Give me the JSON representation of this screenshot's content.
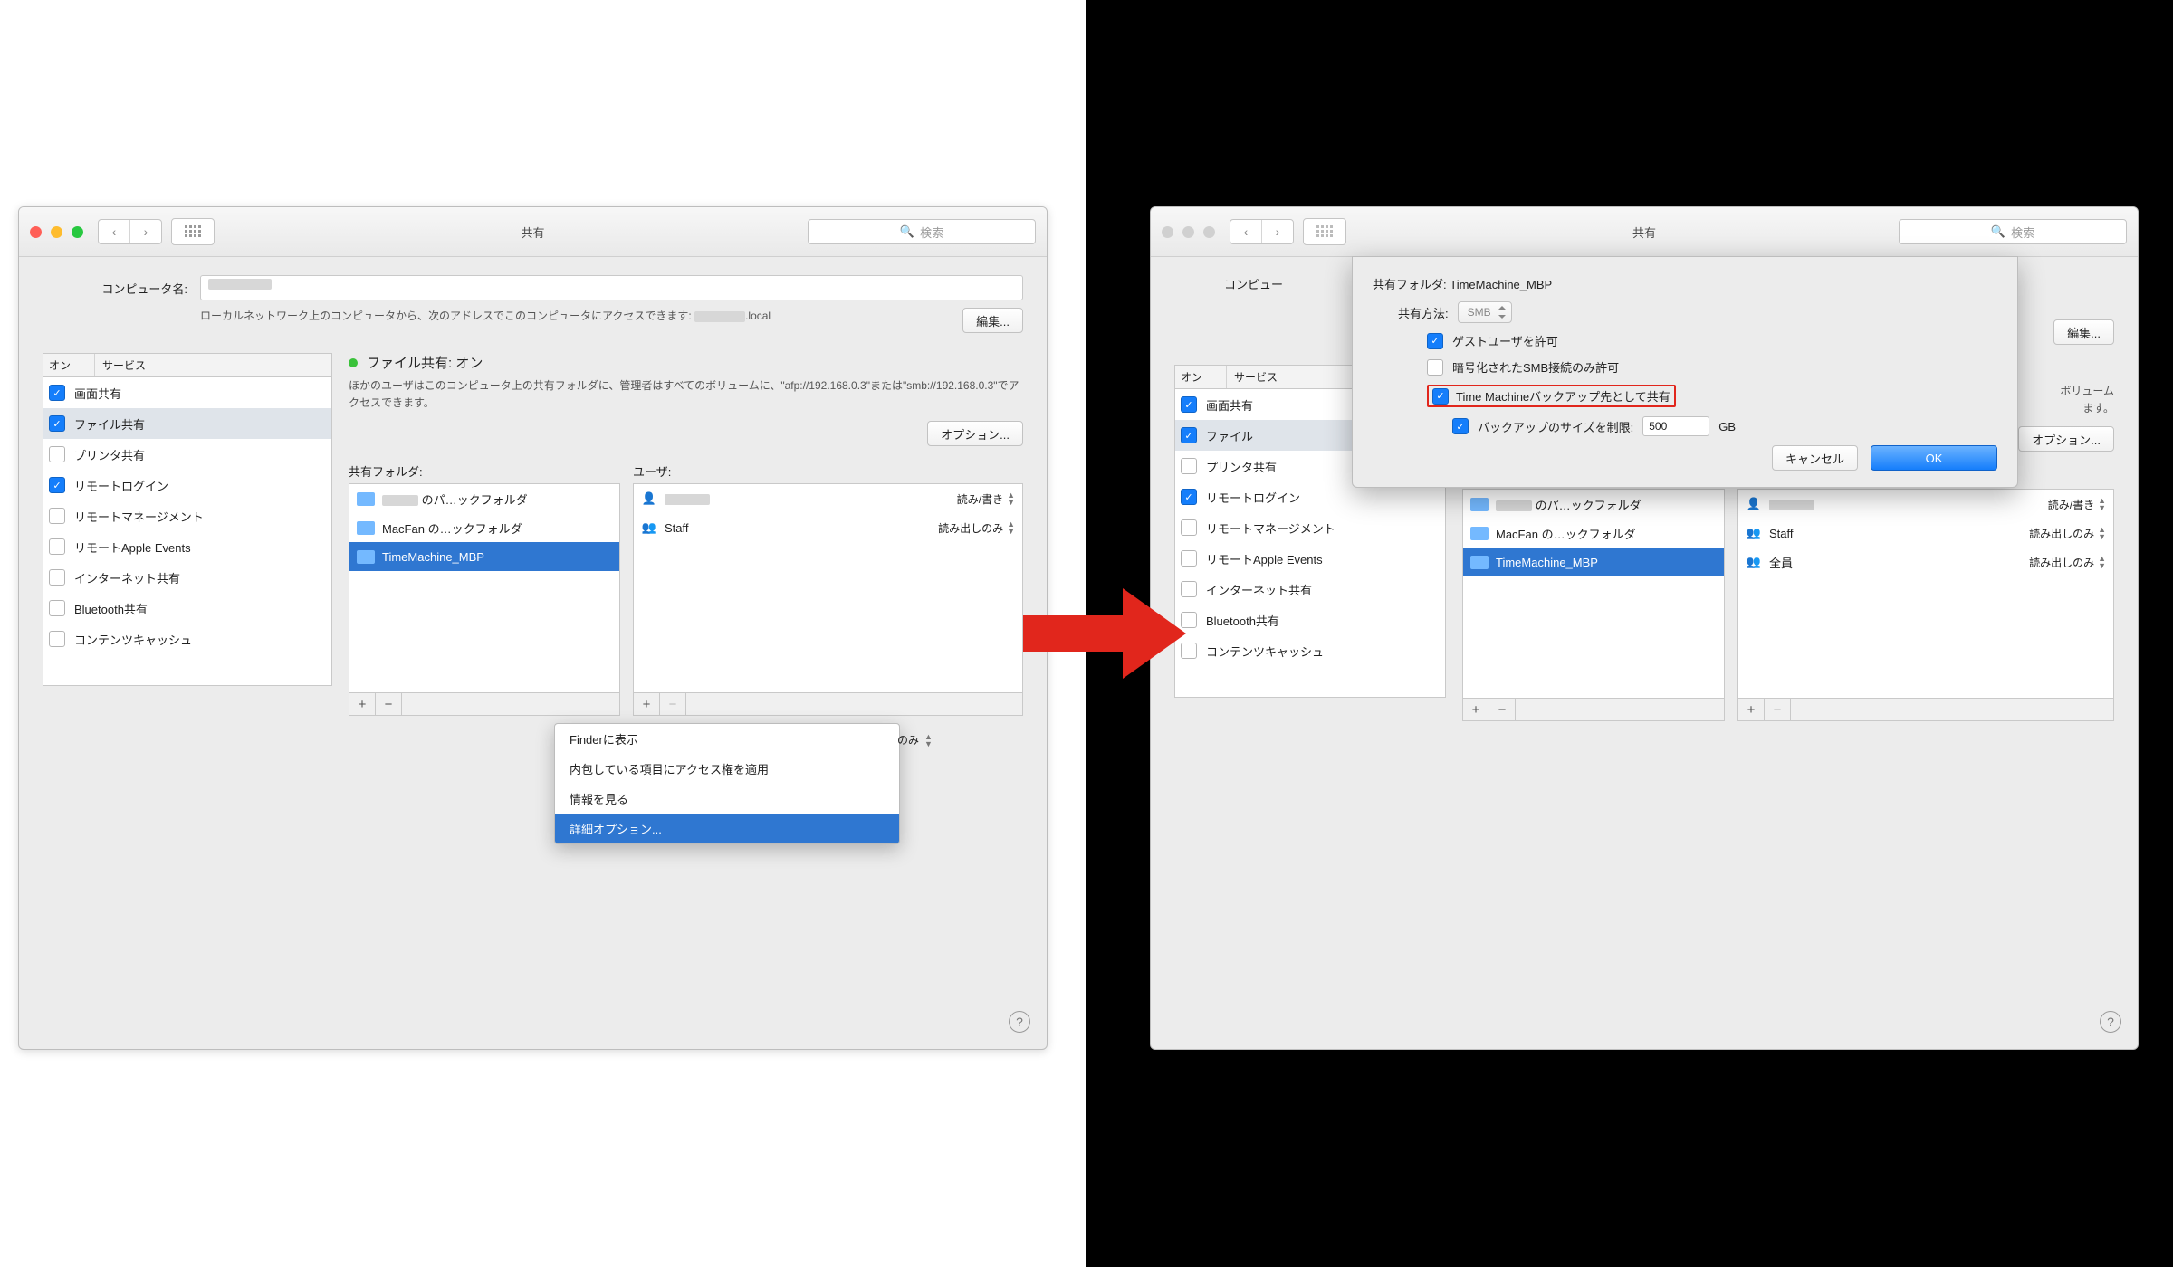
{
  "win": {
    "title": "共有",
    "search_ph": "検索"
  },
  "comp": {
    "label": "コンピュータ名:",
    "hint_pre": "ローカルネットワーク上のコンピュータから、次のアドレスでこのコンピュータにアクセスできます: ",
    "hint_suf": ".local",
    "edit": "編集..."
  },
  "svc": {
    "col_on": "オン",
    "col_svc": "サービス",
    "items": [
      {
        "label": "画面共有",
        "on": true
      },
      {
        "label": "ファイル共有",
        "on": true,
        "sel": true
      },
      {
        "label": "プリンタ共有",
        "on": false
      },
      {
        "label": "リモートログイン",
        "on": true
      },
      {
        "label": "リモートマネージメント",
        "on": false
      },
      {
        "label": "リモートApple Events",
        "on": false
      },
      {
        "label": "インターネット共有",
        "on": false
      },
      {
        "label": "Bluetooth共有",
        "on": false
      },
      {
        "label": "コンテンツキャッシュ",
        "on": false
      }
    ]
  },
  "right": {
    "status": "ファイル共有: オン",
    "hint": "ほかのユーザはこのコンピュータ上の共有フォルダに、管理者はすべてのボリュームに、\"afp://192.168.0.3\"または\"smb://192.168.0.3\"でアクセスできます。",
    "options": "オプション...",
    "folders_h": "共有フォルダ:",
    "users_h": "ユーザ:"
  },
  "folders": [
    {
      "label": " のパ…ックフォルダ",
      "sel": false,
      "redacted": true
    },
    {
      "label": "MacFan の…ックフォルダ",
      "sel": false
    },
    {
      "label": "TimeMachine_MBP",
      "sel": true
    }
  ],
  "users": [
    {
      "label": "",
      "perm": "読み/書き",
      "icon": "user",
      "redacted": true
    },
    {
      "label": "Staff",
      "perm": "読み出しのみ",
      "icon": "group"
    },
    {
      "label": "全員",
      "perm": "読み出しのみ",
      "icon": "group",
      "right_only": true
    }
  ],
  "menu": {
    "items": [
      {
        "label": "Finderに表示"
      },
      {
        "label": "内包している項目にアクセス権を適用"
      },
      {
        "label": "情報を見る"
      },
      {
        "label": "詳細オプション...",
        "sel": true
      }
    ],
    "tail_perm": "のみ"
  },
  "sheet": {
    "title_pre": "共有フォルダ: ",
    "folder": "TimeMachine_MBP",
    "method_label": "共有方法:",
    "method_val": "SMB",
    "guest": "ゲストユーザを許可",
    "enc": "暗号化されたSMB接続のみ許可",
    "tm": "Time Machineバックアップ先として共有",
    "limit": "バックアップのサイズを制限:",
    "limit_val": "500",
    "limit_unit": "GB",
    "cancel": "キャンセル",
    "ok": "OK"
  },
  "rightB": {
    "hint_tail1": "ボリューム",
    "hint_tail2": "ます。"
  }
}
